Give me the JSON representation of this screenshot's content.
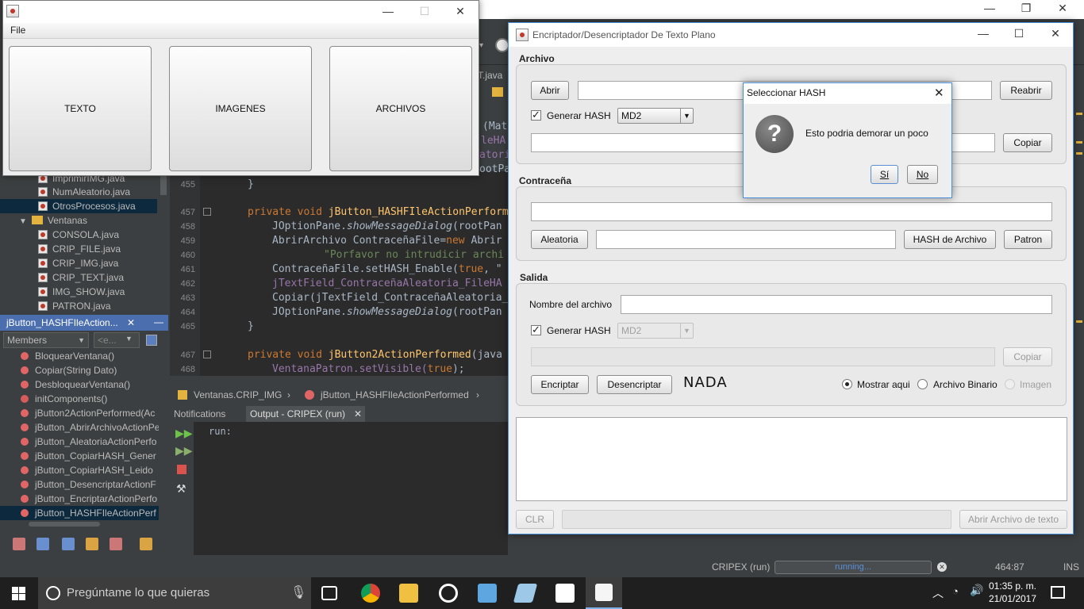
{
  "ide": {
    "tree_items": [
      {
        "label": "ImprimirIMG.java",
        "type": "file"
      },
      {
        "label": "NumAleatorio.java",
        "type": "file"
      },
      {
        "label": "OtrosProcesos.java",
        "type": "file",
        "selected": true
      },
      {
        "label": "Ventanas",
        "type": "folder"
      },
      {
        "label": "CONSOLA.java",
        "type": "file"
      },
      {
        "label": "CRIP_FILE.java",
        "type": "file"
      },
      {
        "label": "CRIP_IMG.java",
        "type": "file"
      },
      {
        "label": "CRIP_TEXT.java",
        "type": "file"
      },
      {
        "label": "IMG_SHOW.java",
        "type": "file"
      },
      {
        "label": "PATRON.java",
        "type": "file"
      }
    ],
    "navigator_title": "jButton_HASHFIleAction...",
    "navigator_combo": "Members",
    "navigator_filter": "<e...",
    "members": [
      "BloquearVentana()",
      "Copiar(String Dato)",
      "DesbloquearVentana()",
      "initComponents()",
      "jButton2ActionPerformed(Ac",
      "jButton_AbrirArchivoActionPe",
      "jButton_AleatoriaActionPerfo",
      "jButton_CopiarHASH_Gener",
      "jButton_CopiarHASH_Leido",
      "jButton_DesencriptarActionF",
      "jButton_EncriptarActionPerfo",
      "jButton_HASHFIleActionPerf"
    ],
    "editor_tab": "T.java",
    "line_numbers": [
      "455",
      "457",
      "458",
      "459",
      "460",
      "461",
      "462",
      "463",
      "464",
      "465",
      "467",
      "468"
    ],
    "code_fragments": {
      "mat": "(Mat",
      "filehash": "leHA",
      "atoria": "atoria",
      "rootpan": "ootPan",
      "l455": "}",
      "l457_kw": "private void",
      "l457_fn": "jButton_HASHFIleActionPerform",
      "l458": "JOptionPane.",
      "l458_it": "showMessageDialog",
      "l458_b": "(rootPan",
      "l459": "AbrirArchivo ContraceñaFile=",
      "l459_kw": "new",
      "l459_b": " Abrir",
      "l460": "\"Porfavor no intrudicir archi",
      "l461": "ContraceñaFile.setHASH_Enable(",
      "l461_kw": "true",
      "l461_b": ", \"",
      "l462": "jTextField_ContraceñaAleatoria_FileHA",
      "l463": "Copiar(jTextField_ContraceñaAleatoria_",
      "l464": "JOptionPane.",
      "l464_it": "showMessageDialog",
      "l464_b": "(rootPan",
      "l465": "}",
      "l467_kw": "private void",
      "l467_fn": "jButton2ActionPerformed",
      "l467_b": "(java",
      "l468": "VentanaPatron.setVisible(",
      "l468_kw": "true",
      "l468_b": ");"
    },
    "breadcrumb_class": "Ventanas.CRIP_IMG",
    "breadcrumb_method": "jButton_HASHFIleActionPerformed",
    "output_tab_notifications": "Notifications",
    "output_tab_output": "Output - CRIPEX (run)",
    "output_text": "run:",
    "status_task": "CRIPEX (run)",
    "status_progress": "running...",
    "status_position": "464:87",
    "status_mode": "INS"
  },
  "menu_window": {
    "menu_file": "File",
    "buttons": [
      "TEXTO",
      "IMAGENES",
      "ARCHIVOS"
    ]
  },
  "enc_window": {
    "title": "Encriptador/Desencriptador De Texto Plano",
    "archivo": {
      "label": "Archivo",
      "abrir": "Abrir",
      "reabrir": "Reabrir",
      "generar_hash": "Generar HASH",
      "hash_algo": "MD2",
      "copiar": "Copiar"
    },
    "contrasena": {
      "label": "Contraceña",
      "aleatoria": "Aleatoria",
      "hash_archivo": "HASH de Archivo",
      "patron": "Patron"
    },
    "salida": {
      "label": "Salida",
      "nombre_archivo": "Nombre del archivo",
      "generar_hash": "Generar HASH",
      "hash_algo": "MD2",
      "copiar": "Copiar",
      "encriptar": "Encriptar",
      "desencriptar": "Desencriptar",
      "nada": "NADA",
      "mostrar_aqui": "Mostrar aqui",
      "archivo_binario": "Archivo Binario",
      "imagen": "Imagen"
    },
    "clr": "CLR",
    "abrir_texto": "Abrir Archivo de texto"
  },
  "dialog": {
    "title": "Seleccionar HASH",
    "message": "Esto podria demorar un poco",
    "yes": "Sí",
    "no": "No"
  },
  "taskbar": {
    "search_placeholder": "Pregúntame lo que quieras",
    "time": "01:35 p. m.",
    "date": "21/01/2017"
  }
}
